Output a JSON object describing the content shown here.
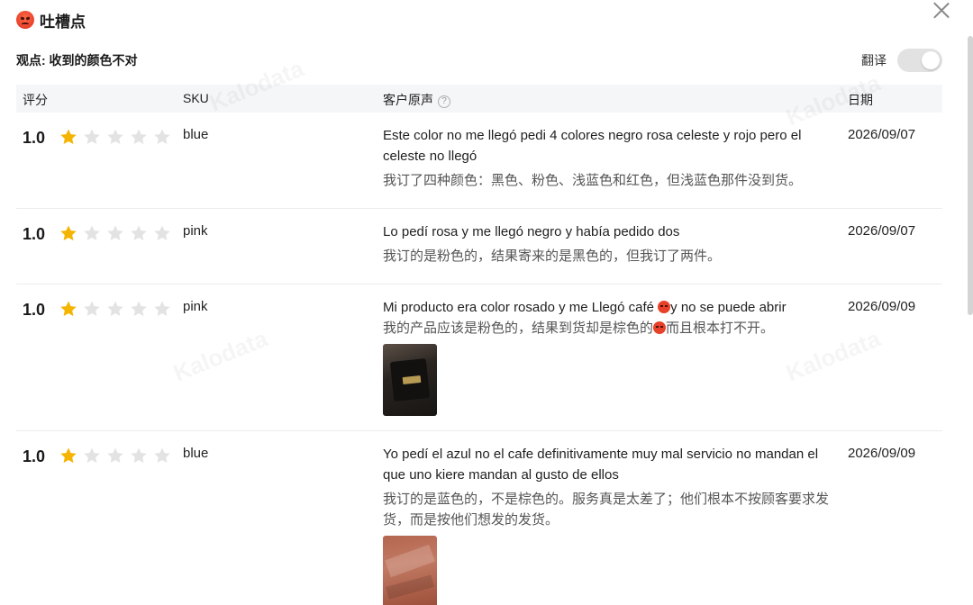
{
  "dialog": {
    "title": "吐槽点",
    "close_label": "×"
  },
  "viewpoint": "观点: 收到的颜色不对",
  "translate": {
    "label": "翻译",
    "enabled": false
  },
  "table": {
    "headers": {
      "rating": "评分",
      "sku": "SKU",
      "voice": "客户原声",
      "voice_help": "?",
      "date": "日期"
    },
    "rows": [
      {
        "score": "1.0",
        "stars": 1,
        "sku": "blue",
        "original": "Este color no me llegó pedi 4 colores negro rosa celeste y rojo pero el celeste no llegó",
        "translation": "我订了四种颜色：黑色、粉色、浅蓝色和红色，但浅蓝色那件没到货。",
        "date": "2026/09/07"
      },
      {
        "score": "1.0",
        "stars": 1,
        "sku": "pink",
        "original": "Lo pedí rosa y me llegó negro y había pedido dos",
        "translation": "我订的是粉色的，结果寄来的是黑色的，但我订了两件。",
        "date": "2026/09/07"
      },
      {
        "score": "1.0",
        "stars": 1,
        "sku": "pink",
        "original_a": "Mi producto era color rosado y me Llegó café ",
        "original_b": "y no se puede abrir",
        "translation_a": "我的产品应该是粉色的，结果到货却是棕色的",
        "translation_b": "而且根本打不开。",
        "date": "2026/09/09",
        "image": "wallet-photo"
      },
      {
        "score": "1.0",
        "stars": 1,
        "sku": "blue",
        "original": "Yo pedí el azul no el cafe definitivamente muy mal servicio no mandan el que uno kiere mandan al gusto de ellos",
        "translation": "我订的是蓝色的，不是棕色的。服务真是太差了；他们根本不按顾客要求发货，而是按他们想发的发货。",
        "date": "2026/09/09",
        "image": "fabric-photo"
      }
    ]
  },
  "colors": {
    "star_on": "#f5b400",
    "star_off": "#e3e3e3",
    "header_bg": "#f5f6f8"
  },
  "watermark": "Kalodata"
}
